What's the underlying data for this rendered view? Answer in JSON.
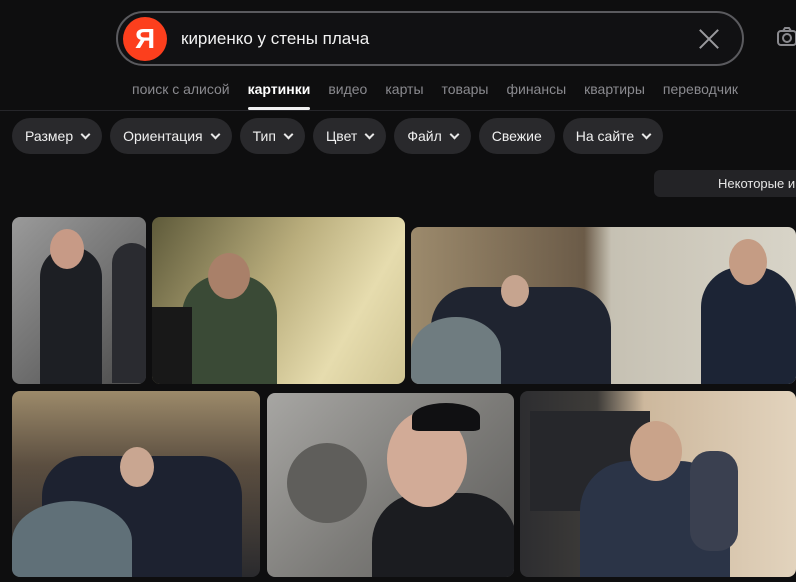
{
  "search": {
    "logo_letter": "Я",
    "query": "кириенко у стены плача"
  },
  "tabs": [
    {
      "label": "поиск с алисой"
    },
    {
      "label": "картинки"
    },
    {
      "label": "видео"
    },
    {
      "label": "карты"
    },
    {
      "label": "товары"
    },
    {
      "label": "финансы"
    },
    {
      "label": "квартиры"
    },
    {
      "label": "переводчик"
    }
  ],
  "active_tab": "картинки",
  "filters": [
    {
      "label": "Размер",
      "dropdown": true
    },
    {
      "label": "Ориентация",
      "dropdown": true
    },
    {
      "label": "Тип",
      "dropdown": true
    },
    {
      "label": "Цвет",
      "dropdown": true
    },
    {
      "label": "Файл",
      "dropdown": true
    },
    {
      "label": "Свежие",
      "dropdown": false
    },
    {
      "label": "На сайте",
      "dropdown": true
    }
  ],
  "notice": "Некоторые и",
  "colors": {
    "background": "#0e0e0f",
    "logo": "#fc3f1d",
    "chip": "#29292c"
  }
}
